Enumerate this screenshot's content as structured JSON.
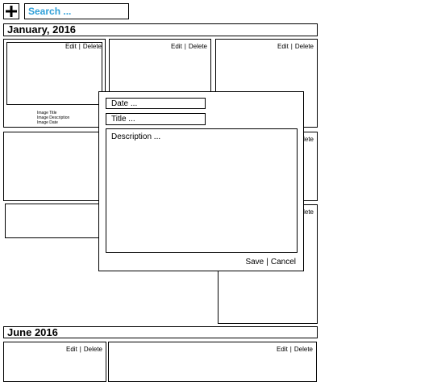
{
  "toolbar": {
    "add_icon": "plus-icon",
    "search_placeholder": "Search ..."
  },
  "sections": [
    {
      "title": "January, 2016"
    },
    {
      "title": "June 2016"
    }
  ],
  "card": {
    "edit_label": "Edit",
    "separator": "|",
    "delete_label": "Delete"
  },
  "image_meta": {
    "title": "Image Title",
    "description": "Image Description",
    "date": "Image Date"
  },
  "dialog": {
    "date_placeholder": "Date ...",
    "title_placeholder": "Title ...",
    "description_placeholder": "Description ...",
    "save_label": "Save",
    "separator": "|",
    "cancel_label": "Cancel"
  },
  "colors": {
    "search_text": "#2e9fd8"
  }
}
